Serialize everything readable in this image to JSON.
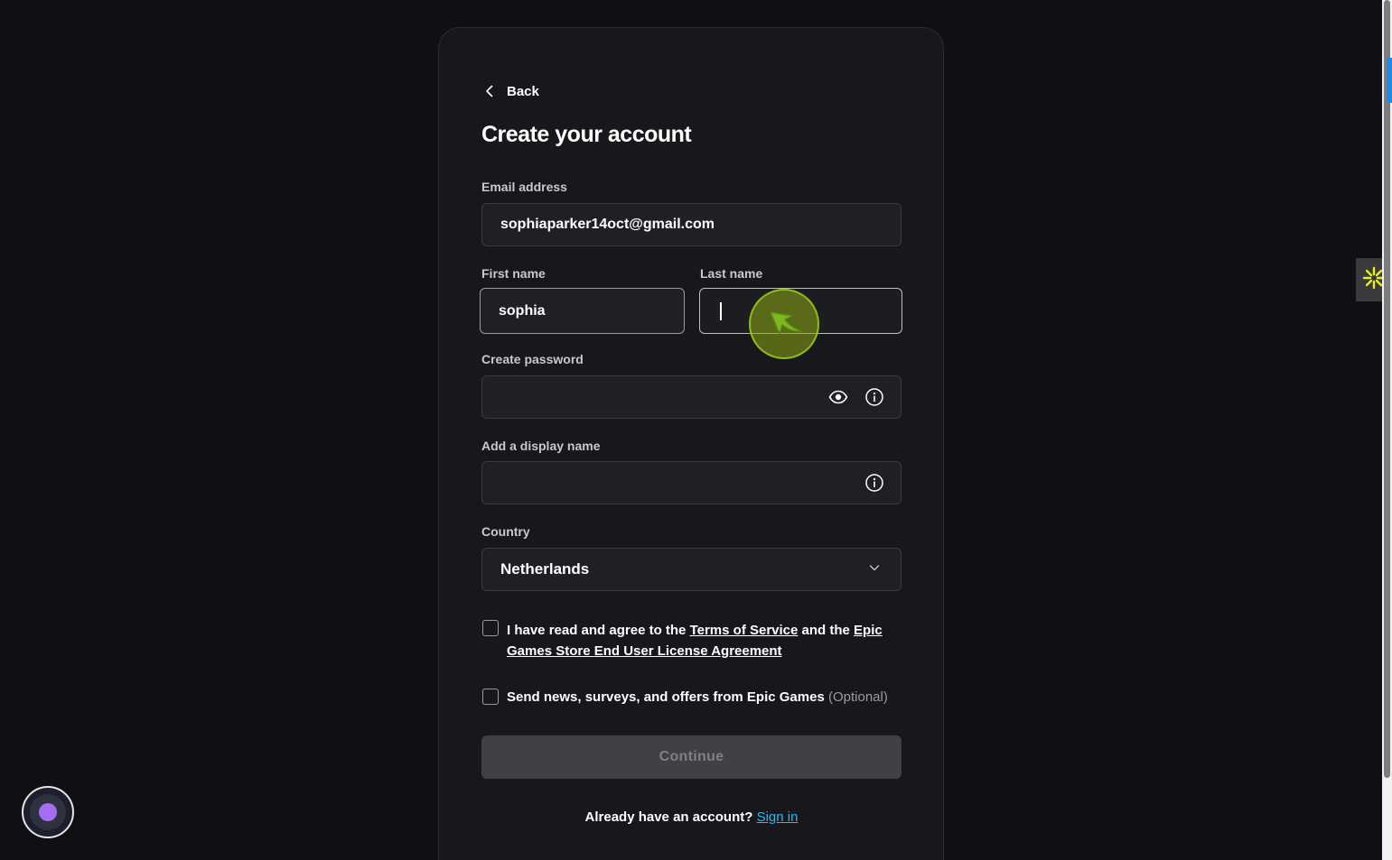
{
  "header": {
    "back_label": "Back",
    "title": "Create your account"
  },
  "form": {
    "email": {
      "label": "Email address",
      "value": "sophiaparker14oct@gmail.com"
    },
    "first_name": {
      "label": "First name",
      "value": "sophia"
    },
    "last_name": {
      "label": "Last name",
      "value": ""
    },
    "password": {
      "label": "Create password",
      "value": ""
    },
    "display_name": {
      "label": "Add a display name",
      "value": ""
    },
    "country": {
      "label": "Country",
      "selected": "Netherlands"
    },
    "terms": {
      "prefix": "I have read and agree to the ",
      "tos_link": "Terms of Service",
      "middle": " and the ",
      "eula_link": "Epic Games Store End User License Agreement",
      "checked": false
    },
    "marketing": {
      "text": "Send news, surveys, and offers from Epic Games",
      "optional": "(Optional)",
      "checked": false
    },
    "continue_label": "Continue"
  },
  "footer": {
    "prompt": "Already have an account?",
    "signin_label": "Sign in"
  },
  "icons": {
    "back": "chevron-left-icon",
    "password_visibility": "eye-icon",
    "password_info": "info-icon",
    "display_name_info": "info-icon",
    "country_dropdown": "chevron-down-icon",
    "cursor": "cursor-arrow-icon",
    "side_widget": "starburst-icon",
    "assistant": "assistant-orb-icon"
  },
  "colors": {
    "background": "#101014",
    "card": "#18181c",
    "link_accent": "#26bbff",
    "button_disabled": "#404046",
    "cursor_highlight": "#8caa14"
  }
}
